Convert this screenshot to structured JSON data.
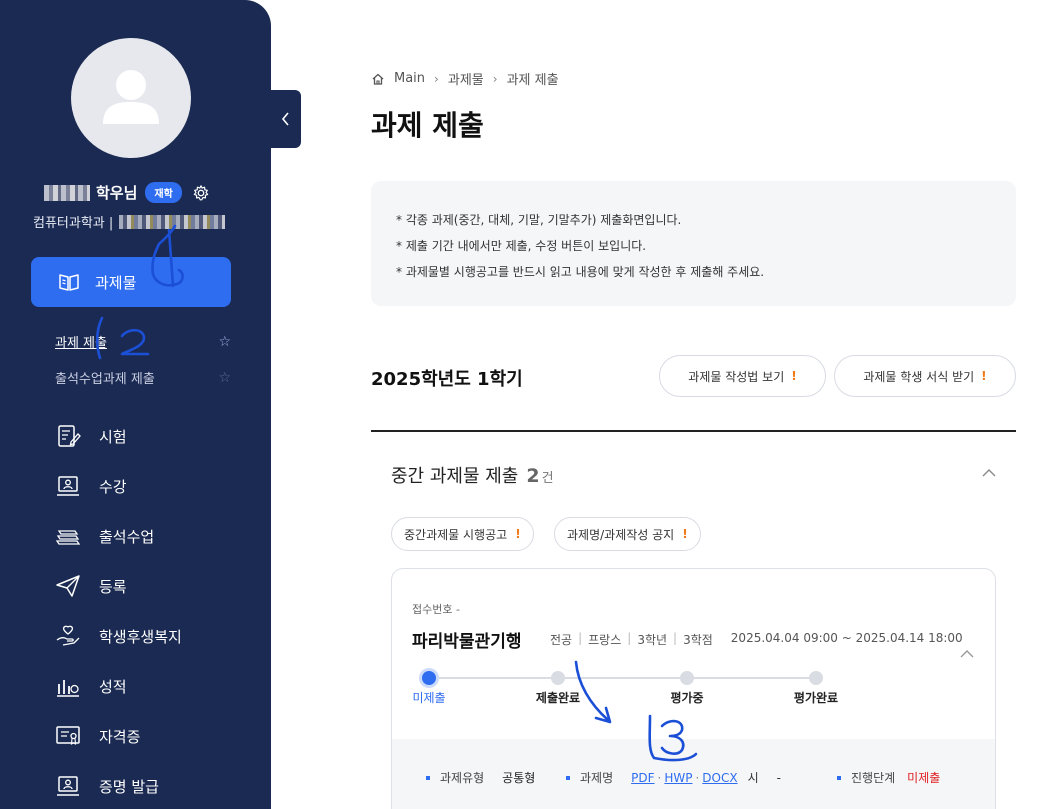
{
  "sidebar": {
    "user_name_suffix": "학우님",
    "status_badge": "재학",
    "department": "컴퓨터과학과 |",
    "active_menu": "과제물",
    "sub_items": [
      {
        "label": "과제 제출"
      },
      {
        "label": "출석수업과제 제출"
      }
    ],
    "menu": [
      {
        "label": "시험",
        "icon": "exam-icon"
      },
      {
        "label": "수강",
        "icon": "lecture-icon"
      },
      {
        "label": "출석수업",
        "icon": "books-icon"
      },
      {
        "label": "등록",
        "icon": "paper-plane-icon"
      },
      {
        "label": "학생후생복지",
        "icon": "welfare-icon"
      },
      {
        "label": "성적",
        "icon": "grade-icon"
      },
      {
        "label": "자격증",
        "icon": "certificate-icon"
      },
      {
        "label": "증명 발급",
        "icon": "document-issue-icon"
      }
    ],
    "toggle_icon": "chevron-left-icon"
  },
  "breadcrumb": [
    "Main",
    "과제물",
    "과제 제출"
  ],
  "page_title": "과제 제출",
  "notice": [
    "* 각종 과제(중간, 대체, 기말, 기말추가) 제출화면입니다.",
    "* 제출 기간 내에서만 제출, 수정 버튼이 보입니다.",
    "* 과제물별 시행공고를 반드시 읽고 내용에 맞게 작성한 후 제출해 주세요."
  ],
  "semester": "2025학년도 1학기",
  "buttons": {
    "guide": "과제물 작성법 보기",
    "form": "과제물 학생 서식 받기"
  },
  "section": {
    "title": "중간 과제물 제출",
    "count": "2",
    "unit": "건",
    "tags": [
      "중간과제물 시행공고",
      "과제명/과제작성 공지"
    ]
  },
  "card": {
    "receipt": "접수번호 -",
    "title": "파리박물관기행",
    "meta": [
      "전공",
      "프랑스",
      "3학년",
      "3학점"
    ],
    "period": "2025.04.04 09:00 ~ 2025.04.14 18:00",
    "steps": [
      "미제출",
      "제출완료",
      "평가중",
      "평가완료"
    ],
    "active_step": 0,
    "details": {
      "type_label": "과제유형",
      "type_value": "공통형",
      "name_label": "과제명",
      "name_links": [
        "PDF",
        "HWP",
        "DOCX"
      ],
      "extra_label": "시",
      "extra_value": "-",
      "stage_label": "진행단계",
      "stage_value": "미제출"
    }
  },
  "annotations": [
    "1",
    "2",
    "3"
  ],
  "colors": {
    "sidebar_bg": "#1b2a52",
    "accent": "#2f6df0",
    "warning": "#f07a17",
    "danger": "#e02020"
  }
}
